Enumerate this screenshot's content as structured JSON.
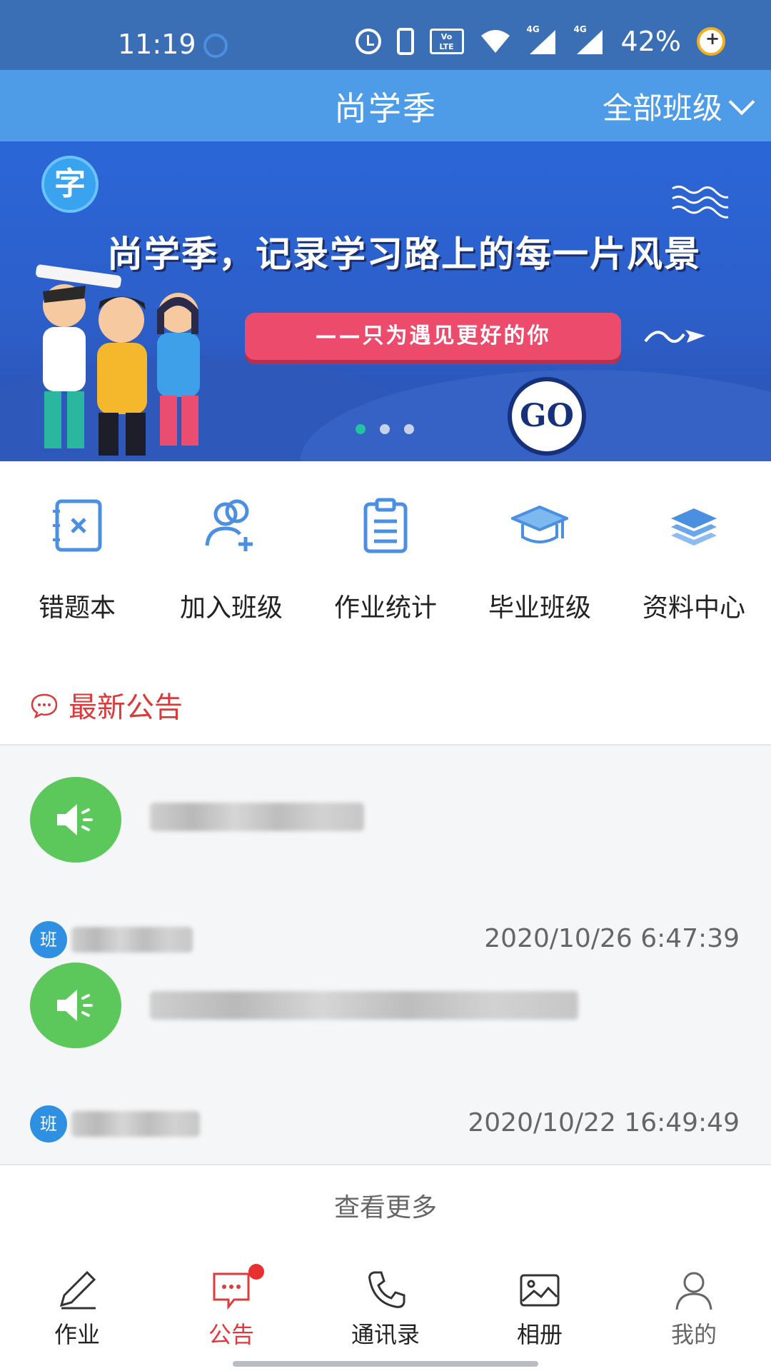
{
  "status_bar": {
    "time": "11:19",
    "network_1": "4G",
    "network_2": "4G",
    "battery": "42%"
  },
  "header": {
    "title": "尚学季",
    "class_filter": "全部班级"
  },
  "banner": {
    "logo_char": "字",
    "headline": "尚学季，记录学习路上的每一片风景",
    "tagline": "——只为遇见更好的你",
    "go_button": "GO",
    "total_slides": 3,
    "active_slide": 1
  },
  "quick_menu": [
    {
      "label": "错题本",
      "icon": "error-book-icon"
    },
    {
      "label": "加入班级",
      "icon": "add-user-icon"
    },
    {
      "label": "作业统计",
      "icon": "clipboard-icon"
    },
    {
      "label": "毕业班级",
      "icon": "graduation-cap-icon"
    },
    {
      "label": "资料中心",
      "icon": "layers-icon"
    }
  ],
  "notices": {
    "title": "最新公告",
    "items": [
      {
        "class_badge": "班",
        "time": "2020/10/26 6:47:39"
      },
      {
        "class_badge": "班",
        "time": "2020/10/22 16:49:49"
      }
    ],
    "more": "查看更多"
  },
  "bottom_nav": [
    {
      "label": "作业",
      "icon": "pencil-icon"
    },
    {
      "label": "公告",
      "icon": "message-icon",
      "active": true,
      "badge": true
    },
    {
      "label": "通讯录",
      "icon": "phone-icon"
    },
    {
      "label": "相册",
      "icon": "image-icon"
    },
    {
      "label": "我的",
      "icon": "user-icon"
    }
  ],
  "colors": {
    "status_bar": "#3b6fb5",
    "header": "#4e9be8",
    "accent_red": "#d83b3b",
    "speaker_green": "#5cc75a",
    "badge_blue": "#2f8fe0"
  }
}
